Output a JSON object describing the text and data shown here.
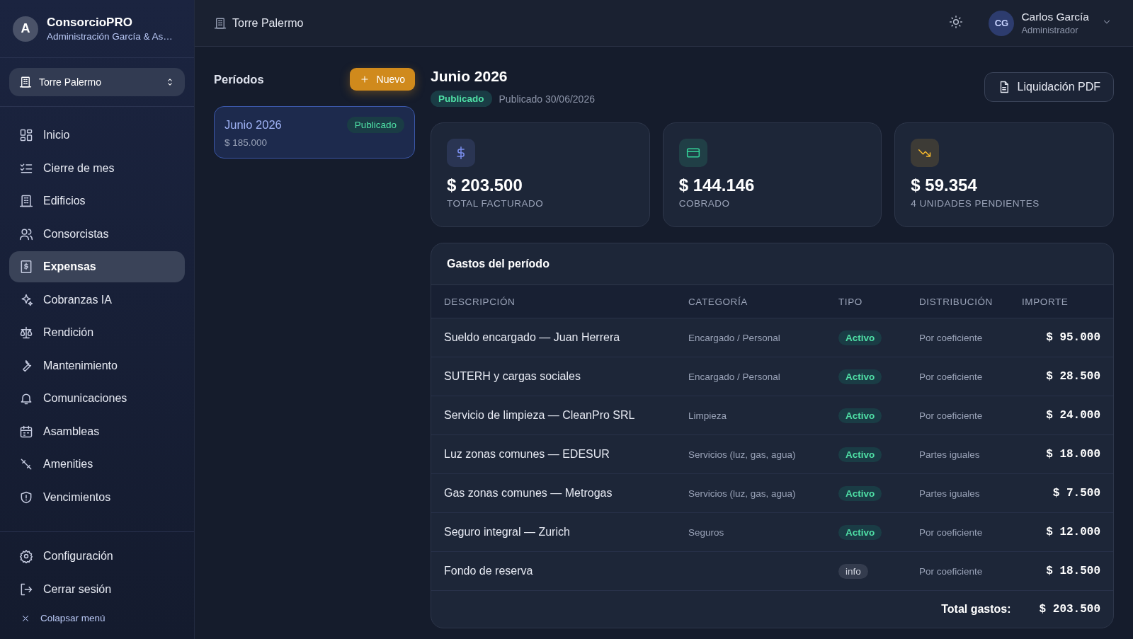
{
  "brand": {
    "avatar": "A",
    "name": "ConsorcioPRO",
    "subtitle": "Administración García & As…"
  },
  "building_selector": {
    "label": "Torre Palermo"
  },
  "nav": [
    {
      "label": "Inicio",
      "selected": false
    },
    {
      "label": "Cierre de mes",
      "selected": false
    },
    {
      "label": "Edificios",
      "selected": false
    },
    {
      "label": "Consorcistas",
      "selected": false
    },
    {
      "label": "Expensas",
      "selected": true
    },
    {
      "label": "Cobranzas IA",
      "selected": false
    },
    {
      "label": "Rendición",
      "selected": false
    },
    {
      "label": "Mantenimiento",
      "selected": false
    },
    {
      "label": "Comunicaciones",
      "selected": false
    },
    {
      "label": "Asambleas",
      "selected": false
    },
    {
      "label": "Amenities",
      "selected": false
    },
    {
      "label": "Vencimientos",
      "selected": false
    }
  ],
  "footer_nav": [
    {
      "label": "Configuración"
    },
    {
      "label": "Cerrar sesión"
    }
  ],
  "collapse": {
    "label": "Colapsar menú"
  },
  "header": {
    "breadcrumb": "Torre Palermo",
    "user": {
      "initials": "CG",
      "name": "Carlos García",
      "role": "Administrador"
    }
  },
  "periods": {
    "title": "Períodos",
    "new_button": "Nuevo",
    "items": [
      {
        "name": "Junio 2026",
        "status": "Publicado",
        "amount": "$ 185.000",
        "selected": true
      }
    ]
  },
  "period_detail": {
    "title": "Junio 2026",
    "status": "Publicado",
    "published": "Publicado 30/06/2026",
    "pdf_button": "Liquidación PDF"
  },
  "stats": [
    {
      "value": "$ 203.500",
      "label": "TOTAL FACTURADO",
      "color": "#7b8ff0"
    },
    {
      "value": "$ 144.146",
      "label": "COBRADO",
      "color": "#34d399"
    },
    {
      "value": "$ 59.354",
      "label": "4 UNIDADES PENDIENTES",
      "color": "#f5b82e"
    }
  ],
  "expenses": {
    "title": "Gastos del período",
    "columns": [
      "DESCRIPCIÓN",
      "CATEGORÍA",
      "TIPO",
      "DISTRIBUCIÓN",
      "IMPORTE"
    ],
    "rows": [
      {
        "description": "Sueldo encargado — Juan Herrera",
        "category": "Encargado / Personal",
        "type": "Activo",
        "kind": "active",
        "distribution": "Por coeficiente",
        "amount": "$ 95.000"
      },
      {
        "description": "SUTERH y cargas sociales",
        "category": "Encargado / Personal",
        "type": "Activo",
        "kind": "active",
        "distribution": "Por coeficiente",
        "amount": "$ 28.500"
      },
      {
        "description": "Servicio de limpieza — CleanPro SRL",
        "category": "Limpieza",
        "type": "Activo",
        "kind": "active",
        "distribution": "Por coeficiente",
        "amount": "$ 24.000"
      },
      {
        "description": "Luz zonas comunes — EDESUR",
        "category": "Servicios (luz, gas, agua)",
        "type": "Activo",
        "kind": "active",
        "distribution": "Partes iguales",
        "amount": "$ 18.000"
      },
      {
        "description": "Gas zonas comunes — Metrogas",
        "category": "Servicios (luz, gas, agua)",
        "type": "Activo",
        "kind": "active",
        "distribution": "Partes iguales",
        "amount": "$ 7.500"
      },
      {
        "description": "Seguro integral — Zurich",
        "category": "Seguros",
        "type": "Activo",
        "kind": "active",
        "distribution": "Por coeficiente",
        "amount": "$ 12.000"
      },
      {
        "description": "Fondo de reserva",
        "type": "info",
        "kind": "info",
        "distribution": "Por coeficiente",
        "amount": "$ 18.500"
      }
    ],
    "total_label": "Total gastos:",
    "total": "$ 203.500"
  }
}
